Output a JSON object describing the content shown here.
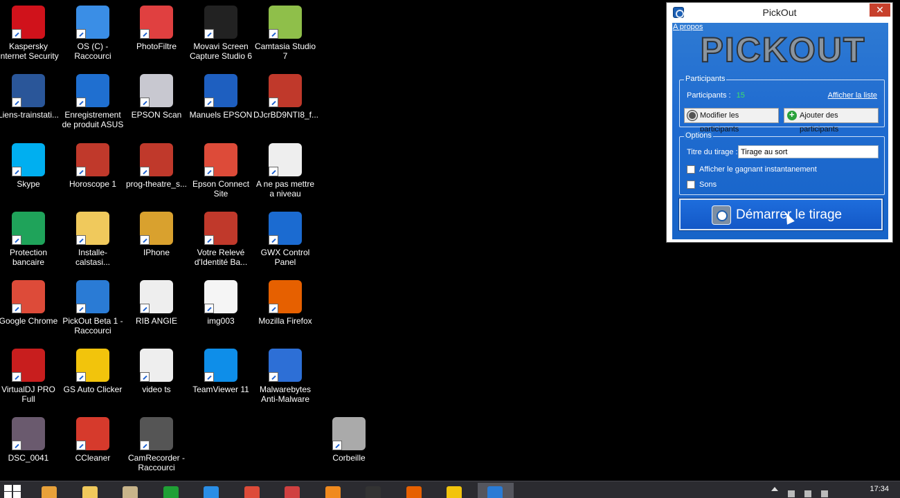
{
  "desktop_icons": [
    {
      "label": "Kaspersky Internet Security",
      "icon": "kaspersky-icon",
      "color": "#d0121b"
    },
    {
      "label": "OS (C) - Raccourci",
      "icon": "drive-icon",
      "color": "#3a8ee6"
    },
    {
      "label": "PhotoFiltre",
      "icon": "photofiltre-icon",
      "color": "#e04040"
    },
    {
      "label": "Movavi Screen Capture Studio 6",
      "icon": "movavi-icon",
      "color": "#222222"
    },
    {
      "label": "Camtasia Studio 7",
      "icon": "camtasia-icon",
      "color": "#8fbf4a"
    },
    {
      "label": "Liens-trainstati...",
      "icon": "word-document-icon",
      "color": "#2a5699"
    },
    {
      "label": "Enregistrement de produit ASUS",
      "icon": "asus-icon",
      "color": "#1f6fd0"
    },
    {
      "label": "EPSON Scan",
      "icon": "scanner-icon",
      "color": "#c8c8d0"
    },
    {
      "label": "Manuels EPSON",
      "icon": "epson-manual-icon",
      "color": "#1e5fc0"
    },
    {
      "label": "DJcrBD9NTI8_f...",
      "icon": "pdf-icon",
      "color": "#c0392b"
    },
    {
      "label": "Skype",
      "icon": "skype-icon",
      "color": "#00aff0"
    },
    {
      "label": "Horoscope 1",
      "icon": "pdf-icon",
      "color": "#c0392b"
    },
    {
      "label": "prog-theatre_s...",
      "icon": "pdf-icon",
      "color": "#c0392b"
    },
    {
      "label": "Epson Connect Site",
      "icon": "chrome-icon",
      "color": "#dd4b39"
    },
    {
      "label": "A ne pas mettre a niveau",
      "icon": "text-file-icon",
      "color": "#eeeeee"
    },
    {
      "label": "Protection bancaire",
      "icon": "bank-card-icon",
      "color": "#1fa35a"
    },
    {
      "label": "Installe-calstasi...",
      "icon": "folder-icon",
      "color": "#f0c95c"
    },
    {
      "label": "IPhone",
      "icon": "folder-icon",
      "color": "#d9a12e"
    },
    {
      "label": "Votre Relevé d'Identité Ba...",
      "icon": "pdf-icon",
      "color": "#c0392b"
    },
    {
      "label": "GWX Control Panel",
      "icon": "gwx-icon",
      "color": "#1b6bd1"
    },
    {
      "label": "Google Chrome",
      "icon": "chrome-icon",
      "color": "#dd4b39"
    },
    {
      "label": "PickOut Beta 1 - Raccourci",
      "icon": "pickout-icon",
      "color": "#2a7bd5"
    },
    {
      "label": "RIB ANGIE",
      "icon": "document-strip-icon",
      "color": "#eeeeee"
    },
    {
      "label": "img003",
      "icon": "image-document-icon",
      "color": "#f5f5f5"
    },
    {
      "label": "Mozilla Firefox",
      "icon": "firefox-icon",
      "color": "#e66000"
    },
    {
      "label": "VirtualDJ PRO Full",
      "icon": "virtualdj-icon",
      "color": "#c81e1e"
    },
    {
      "label": "GS Auto Clicker",
      "icon": "star-icon",
      "color": "#f2c40c"
    },
    {
      "label": "video ts",
      "icon": "text-file-icon",
      "color": "#eeeeee"
    },
    {
      "label": "TeamViewer 11",
      "icon": "teamviewer-icon",
      "color": "#0e8ee9"
    },
    {
      "label": "Malwarebytes Anti-Malware",
      "icon": "malwarebytes-icon",
      "color": "#2d6fd6"
    },
    {
      "label": "DSC_0041",
      "icon": "photo-thumbnail-icon",
      "color": "#6a5a6e"
    },
    {
      "label": "CCleaner",
      "icon": "ccleaner-icon",
      "color": "#d63a2c"
    },
    {
      "label": "CamRecorder - Raccourci",
      "icon": "camrecorder-icon",
      "color": "#555555"
    },
    {
      "label": "Corbeille",
      "icon": "recycle-bin-icon",
      "color": "#aaaaaa"
    }
  ],
  "pickout_window": {
    "title": "PickOut",
    "close_label": "✕",
    "about_link": "A propos",
    "logo_text": "PICKOUT",
    "participants_group": {
      "legend": "Participants",
      "label": "Participants :",
      "count": "15",
      "show_list_link": "Afficher la liste",
      "edit_button": "Modifier les participants",
      "add_button": "Ajouter des participants"
    },
    "options_group": {
      "legend": "Options",
      "title_label": "Titre du tirage :",
      "title_value": "Tirage au sort",
      "checkbox_instant_winner": "Afficher le gagnant instantanement",
      "checkbox_instant_winner_checked": false,
      "checkbox_sounds": "Sons",
      "checkbox_sounds_checked": false
    },
    "start_button": "Démarrer le tirage"
  },
  "taskbar": {
    "apps": [
      {
        "icon": "start-icon"
      },
      {
        "icon": "picasa-icon",
        "color": "#e8a13a"
      },
      {
        "icon": "file-explorer-icon",
        "color": "#f0c95c"
      },
      {
        "icon": "notes-icon",
        "color": "#c8b48a"
      },
      {
        "icon": "store-icon",
        "color": "#1fa035"
      },
      {
        "icon": "internet-explorer-icon",
        "color": "#2a8ee6"
      },
      {
        "icon": "chrome-icon",
        "color": "#dd4b39"
      },
      {
        "icon": "scissors-icon",
        "color": "#d04040"
      },
      {
        "icon": "media-player-icon",
        "color": "#f08a1e"
      },
      {
        "icon": "movavi-icon",
        "color": "#333333"
      },
      {
        "icon": "firefox-icon",
        "color": "#e66000"
      },
      {
        "icon": "star-icon",
        "color": "#f2c40c"
      },
      {
        "icon": "pickout-icon",
        "color": "#2a7bd5"
      }
    ],
    "clock_time": "17:34"
  }
}
